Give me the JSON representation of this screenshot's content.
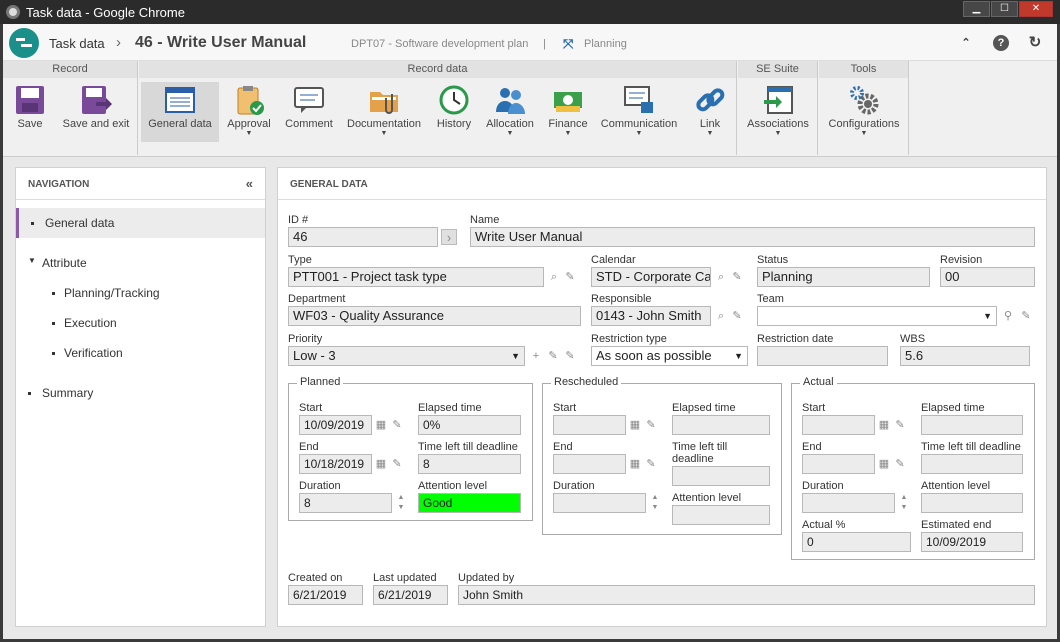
{
  "window": {
    "title": "Task data - Google Chrome",
    "min": "▁",
    "max": "☐",
    "close": "✕"
  },
  "header": {
    "crumb_root": "Task data",
    "crumb_sep": "›",
    "crumb_task": "46 - Write User Manual",
    "crumb_plan": "DPT07 - Software development plan",
    "crumb_div": "|",
    "crumb_status": "Planning"
  },
  "ribbon": {
    "groups": {
      "record": "Record",
      "record_data": "Record data",
      "se_suite": "SE Suite",
      "tools": "Tools"
    },
    "buttons": {
      "save": "Save",
      "save_exit": "Save and exit",
      "general": "General data",
      "approval": "Approval",
      "comment": "Comment",
      "documentation": "Documentation",
      "history": "History",
      "allocation": "Allocation",
      "finance": "Finance",
      "communication": "Communication",
      "link": "Link",
      "associations": "Associations",
      "configurations": "Configurations"
    },
    "dropdown_glyph": "▼"
  },
  "nav": {
    "title": "NAVIGATION",
    "collapse": "«",
    "items": [
      "General data",
      "Attribute",
      "Planning/Tracking",
      "Execution",
      "Verification",
      "Summary"
    ]
  },
  "main": {
    "title": "GENERAL DATA"
  },
  "form": {
    "id_label": "ID #",
    "id_value": "46",
    "name_label": "Name",
    "name_value": "Write User Manual",
    "type_label": "Type",
    "type_value": "PTT001 - Project task type",
    "calendar_label": "Calendar",
    "calendar_value": "STD - Corporate Calendar",
    "status_label": "Status",
    "status_value": "Planning",
    "revision_label": "Revision",
    "revision_value": "00",
    "department_label": "Department",
    "department_value": "WF03 - Quality Assurance",
    "responsible_label": "Responsible",
    "responsible_value": "0143 - John Smith",
    "team_label": "Team",
    "team_value": "",
    "priority_label": "Priority",
    "priority_value": "Low - 3",
    "restriction_type_label": "Restriction type",
    "restriction_type_value": "As soon as possible",
    "restriction_date_label": "Restriction date",
    "restriction_date_value": "",
    "wbs_label": "WBS",
    "wbs_value": "5.6",
    "planned": {
      "legend": "Planned",
      "start_label": "Start",
      "start": "10/09/2019",
      "elapsed_label": "Elapsed time",
      "elapsed": "0%",
      "end_label": "End",
      "end": "10/18/2019",
      "left_label": "Time left till deadline",
      "left": "8",
      "duration_label": "Duration",
      "duration": "8",
      "attention_label": "Attention level",
      "attention": "Good"
    },
    "rescheduled": {
      "legend": "Rescheduled",
      "start_label": "Start",
      "elapsed_label": "Elapsed time",
      "end_label": "End",
      "left_label": "Time left till deadline",
      "duration_label": "Duration",
      "attention_label": "Attention level"
    },
    "actual": {
      "legend": "Actual",
      "start_label": "Start",
      "elapsed_label": "Elapsed time",
      "end_label": "End",
      "left_label": "Time left till deadline",
      "duration_label": "Duration",
      "attention_label": "Attention level",
      "pct_label": "Actual %",
      "pct": "0",
      "est_end_label": "Estimated end",
      "est_end": "10/09/2019"
    },
    "created_label": "Created on",
    "created": "6/21/2019",
    "updated_label": "Last updated",
    "updated": "6/21/2019",
    "updated_by_label": "Updated by",
    "updated_by": "John Smith"
  },
  "colors": {
    "attention_good": "#00ff00",
    "accent": "#1b8f8a",
    "nav_selected_bar": "#8a5aa8"
  },
  "glyphs": {
    "search": "⌕",
    "clear": "✎",
    "calendar": "▦",
    "arrow_right": "›",
    "plus": "+",
    "up": "▲",
    "down": "▼",
    "binoculars": "⚲"
  }
}
